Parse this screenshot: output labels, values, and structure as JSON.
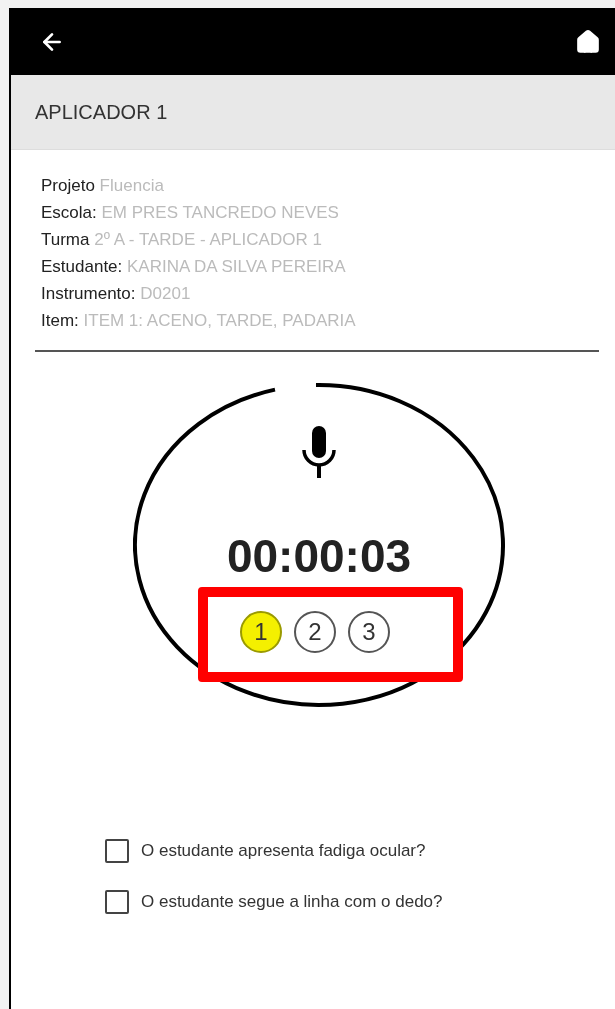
{
  "header": {
    "title": "APLICADOR 1"
  },
  "details": [
    {
      "label": "Projeto",
      "value": "Fluencia"
    },
    {
      "label": "Escola:",
      "value": "EM PRES TANCREDO NEVES"
    },
    {
      "label": "Turma",
      "value": "2º A - TARDE - APLICADOR 1"
    },
    {
      "label": "Estudante:",
      "value": "KARINA DA SILVA PEREIRA"
    },
    {
      "label": "Instrumento:",
      "value": "D0201"
    },
    {
      "label": "Item:",
      "value": "ITEM 1: ACENO, TARDE, PADARIA"
    }
  ],
  "recorder": {
    "timer": "00:00:03",
    "attempts": [
      {
        "label": "1",
        "selected": true
      },
      {
        "label": "2",
        "selected": false
      },
      {
        "label": "3",
        "selected": false
      }
    ]
  },
  "questions": [
    {
      "label": "O estudante apresenta fadiga ocular?",
      "checked": false
    },
    {
      "label": "O estudante segue a linha com o dedo?",
      "checked": false
    }
  ]
}
